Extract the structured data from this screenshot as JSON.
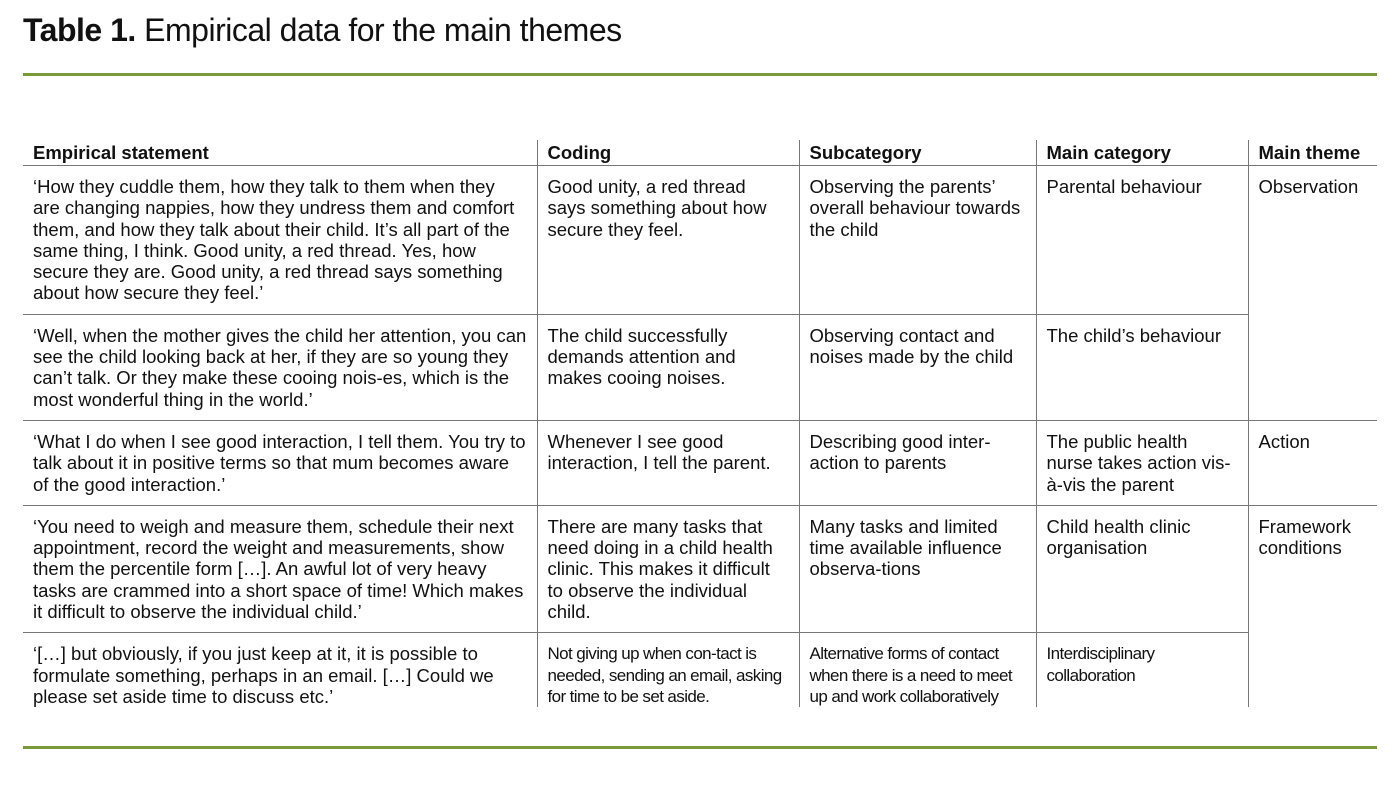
{
  "title": {
    "label": "Table 1.",
    "text": "Empirical data for the main themes"
  },
  "colors": {
    "accent_rule": "#7a9a3a",
    "grid_line": "#777777"
  },
  "table": {
    "headers": [
      "Empirical statement",
      "Coding",
      "Subcategory",
      "Main category",
      "Main theme"
    ],
    "rows": [
      {
        "statement": "‘How they cuddle them, how they talk to them when they are changing nappies, how they undress them and comfort them, and how they talk about their child. It’s all part of the same thing, I think. Good unity, a red thread. Yes, how secure they are. Good unity, a red thread says something about how secure they feel.’",
        "coding": "Good unity, a red thread says something about how secure they feel.",
        "subcategory": "Observing the parents’ overall behaviour towards the child",
        "main_category": "Parental behaviour",
        "main_theme": "Observation"
      },
      {
        "statement": "‘Well, when the mother gives the child her attention, you can see the child looking back at her, if they are so young they can’t talk. Or they make these cooing nois-es, which is the most wonderful thing in the world.’",
        "coding": "The child successfully demands attention and makes cooing noises.",
        "subcategory": "Observing contact and noises made by the child",
        "main_category": "The child’s behaviour",
        "main_theme": ""
      },
      {
        "statement": "‘What I do when I see good interaction, I tell them. You try to talk about it in positive terms so that mum becomes aware of the good interaction.’",
        "coding": "Whenever I see good interaction, I tell the parent.",
        "subcategory": "Describing good inter-action to parents",
        "main_category": "The public health nurse takes action vis-à-vis the parent",
        "main_theme": "Action"
      },
      {
        "statement": "‘You need to weigh and measure them, schedule their next appointment, record the weight and measurements, show them the percentile form […]. An awful lot of very heavy tasks are crammed into a short space of time! Which makes it difficult to observe the individual child.’",
        "coding": "There are many tasks that need doing in a child health clinic. This makes it difficult to observe the individual child.",
        "subcategory": "Many tasks and limited time available influence observa-tions",
        "main_category": "Child health clinic organisation",
        "main_theme": "Framework conditions"
      },
      {
        "statement": "‘[…] but obviously, if you just keep at it, it is possible to formulate something, perhaps in an email. […] Could we please set aside time to discuss etc.’",
        "coding": "Not giving up when con-tact is needed, sending an email, asking for time to be set aside.",
        "subcategory": "Alternative forms of contact when there is a need to meet up and work collaboratively",
        "main_category": "Interdisciplinary collaboration",
        "main_theme": ""
      }
    ]
  }
}
